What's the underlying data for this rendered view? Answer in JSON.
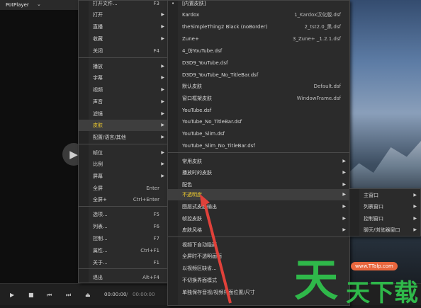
{
  "app": {
    "name": "PotPlayer",
    "menu_arrow": "⌄"
  },
  "player": {
    "big_play_icon": "▶",
    "time_current": "00:00:00",
    "time_sep": "/",
    "time_total": "00:00:00"
  },
  "controls": {
    "icons": [
      "play-icon",
      "stop-icon",
      "prev-icon",
      "next-icon",
      "eject-icon"
    ]
  },
  "main_menu": {
    "items": [
      {
        "label": "打开文件...",
        "shortcut": "F3",
        "arrow": false
      },
      {
        "label": "打开",
        "shortcut": "",
        "arrow": true
      },
      {
        "label": "直播",
        "shortcut": "",
        "arrow": true
      },
      {
        "label": "收藏",
        "shortcut": "",
        "arrow": true
      },
      {
        "label": "关闭",
        "shortcut": "F4",
        "arrow": false
      },
      {
        "label": "播放",
        "shortcut": "",
        "arrow": true
      },
      {
        "label": "字幕",
        "shortcut": "",
        "arrow": true
      },
      {
        "label": "视频",
        "shortcut": "",
        "arrow": true
      },
      {
        "label": "声音",
        "shortcut": "",
        "arrow": true
      },
      {
        "label": "滤镜",
        "shortcut": "",
        "arrow": true
      },
      {
        "label": "皮肤",
        "shortcut": "",
        "arrow": true,
        "highlight": true
      },
      {
        "label": "配置/语言/其他",
        "shortcut": "",
        "arrow": true
      },
      {
        "label": "帧位",
        "shortcut": "",
        "arrow": true
      },
      {
        "label": "比例",
        "shortcut": "",
        "arrow": true
      },
      {
        "label": "屏幕",
        "shortcut": "",
        "arrow": true
      },
      {
        "label": "全屏",
        "shortcut": "Enter",
        "arrow": false
      },
      {
        "label": "全屏+",
        "shortcut": "Ctrl+Enter",
        "arrow": false
      },
      {
        "label": "选项...",
        "shortcut": "F5",
        "arrow": false
      },
      {
        "label": "列表...",
        "shortcut": "F6",
        "arrow": false
      },
      {
        "label": "控制...",
        "shortcut": "F7",
        "arrow": false
      },
      {
        "label": "属性...",
        "shortcut": "Ctrl+F1",
        "arrow": false
      },
      {
        "label": "关于...",
        "shortcut": "F1",
        "arrow": false
      },
      {
        "label": "退出",
        "shortcut": "Alt+F4",
        "arrow": false
      }
    ]
  },
  "skin_menu": {
    "items": [
      {
        "label": "[内置皮肤]",
        "shortcut": "",
        "check": true
      },
      {
        "label": "Kardox",
        "shortcut": "1_Kardox汉化版.dsf"
      },
      {
        "label": "theSimpleThing2 Black (noBorder)",
        "shortcut": "2_tst2.0_黑.dsf"
      },
      {
        "label": "Zune+",
        "shortcut": "3_Zune+ _1.2.1.dsf"
      },
      {
        "label": "4_仿YouTube.dsf",
        "shortcut": ""
      },
      {
        "label": "D3D9_YouTube.dsf",
        "shortcut": ""
      },
      {
        "label": "D3D9_YouTube_No_TitleBar.dsf",
        "shortcut": ""
      },
      {
        "label": "默认皮肤",
        "shortcut": "Default.dsf"
      },
      {
        "label": "窗口框架皮肤",
        "shortcut": "WindowFrame.dsf"
      },
      {
        "label": "YouTube.dsf",
        "shortcut": ""
      },
      {
        "label": "YouTube_No_TitleBar.dsf",
        "shortcut": ""
      },
      {
        "label": "YouTube_Slim.dsf",
        "shortcut": ""
      },
      {
        "label": "YouTube_Slim_No_TitleBar.dsf",
        "shortcut": ""
      },
      {
        "label": "常用皮肤",
        "shortcut": "",
        "arrow": true
      },
      {
        "label": "播放时的皮肤",
        "shortcut": "",
        "arrow": true
      },
      {
        "label": "配色",
        "shortcut": "",
        "arrow": true
      },
      {
        "label": "不透明度",
        "shortcut": "",
        "arrow": true,
        "highlight": true
      },
      {
        "label": "图层式皮肤输出",
        "shortcut": "",
        "arrow": true
      },
      {
        "label": "帧控皮肤",
        "shortcut": "",
        "arrow": true
      },
      {
        "label": "皮肤风格",
        "shortcut": "",
        "arrow": true
      },
      {
        "label": "视频下自动隐藏",
        "shortcut": ""
      },
      {
        "label": "全屏时不透明画面",
        "shortcut": ""
      },
      {
        "label": "以视频区缺省...",
        "shortcut": ""
      },
      {
        "label": "不切换界面模式",
        "shortcut": ""
      },
      {
        "label": "单独保存音视/视频界面位置/尺寸",
        "shortcut": ""
      }
    ]
  },
  "opacity_menu": {
    "items": [
      {
        "label": "主窗口",
        "arrow": true
      },
      {
        "label": "列表窗口",
        "arrow": true
      },
      {
        "label": "控制窗口",
        "arrow": true
      },
      {
        "label": "聊天/浏览器窗口",
        "arrow": true
      }
    ]
  },
  "watermark": {
    "big1": "天",
    "big2": "天",
    "big3": "下",
    "big4": "载",
    "site": "www.TTalp.com"
  },
  "colors": {
    "highlight_text": "#f5d02e",
    "menu_bg": "#2b2b2b",
    "watermark_green": "#2fb84a",
    "arrow_red": "#e0413a"
  }
}
